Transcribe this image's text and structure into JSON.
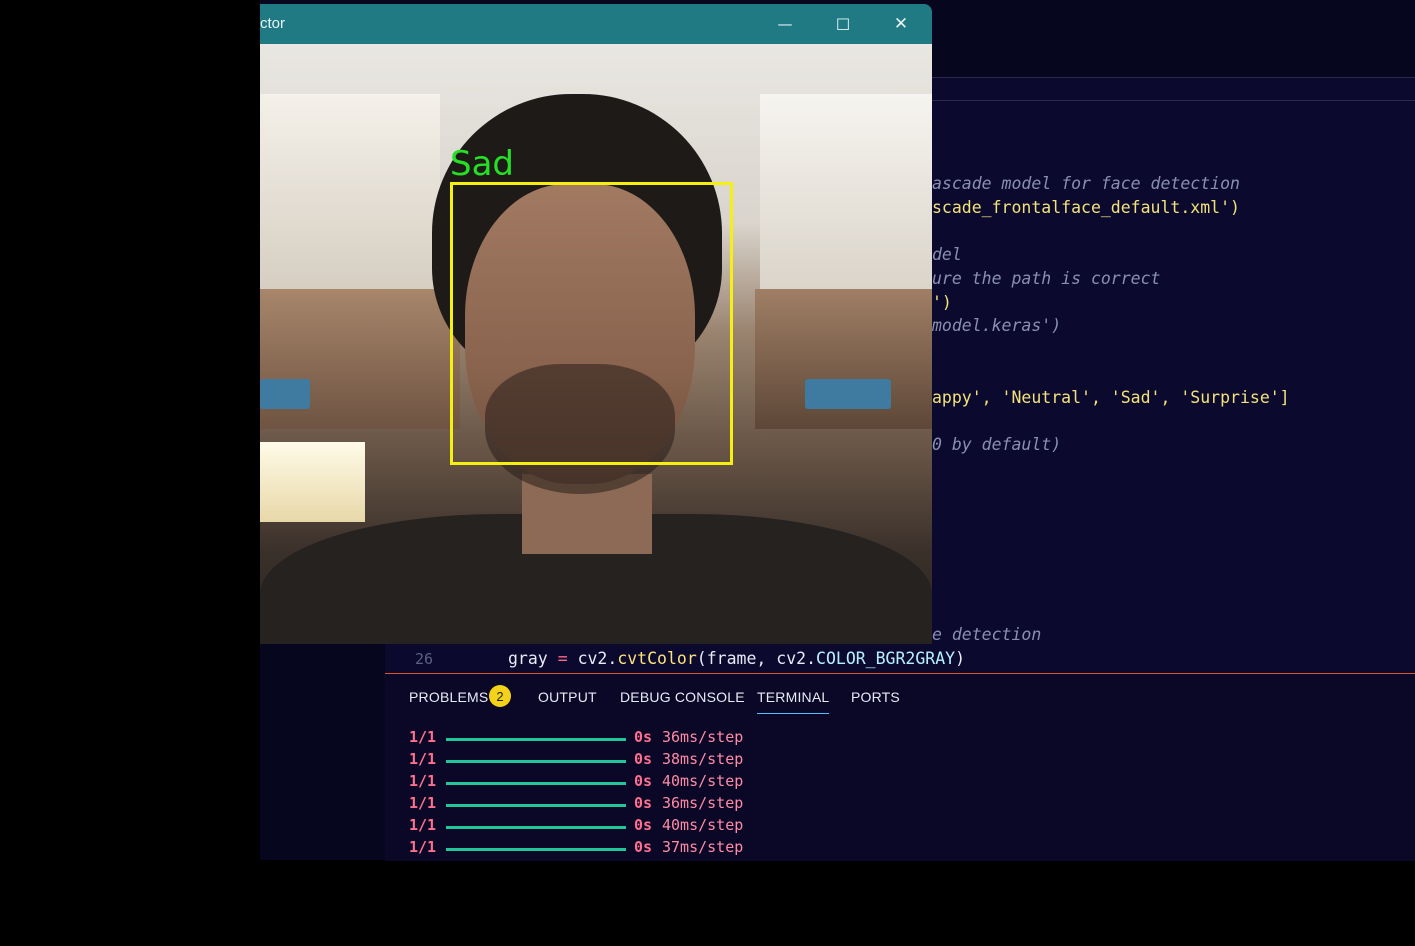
{
  "window": {
    "title": "ctor",
    "minimize_glyph": "—",
    "maximize_glyph": "☐",
    "close_glyph": "✕"
  },
  "camera": {
    "emotion_label": "Sad",
    "box_color": "#f5ef12",
    "label_color": "#25e025"
  },
  "editor": {
    "lines": [
      {
        "text": "ascade model for face detection",
        "kind": "cmt"
      },
      {
        "text": "scade_frontalface_default.xml')",
        "kind": "str"
      },
      {
        "text": "del",
        "kind": "cmt"
      },
      {
        "text": "ure the path is correct",
        "kind": "cmt"
      },
      {
        "text": "')",
        "kind": "str"
      },
      {
        "text": "model.keras')",
        "kind": "cmt"
      },
      {
        "text": "appy', 'Neutral', 'Sad', 'Surprise']",
        "kind": "str"
      },
      {
        "text": "0 by default)",
        "kind": "cmt"
      },
      {
        "text": "e detection",
        "kind": "cmt"
      }
    ],
    "line26": {
      "number": "26",
      "var": "gray",
      "op": "=",
      "module": "cv2.",
      "func": "cvtColor",
      "args_open": "(frame, cv2.",
      "const": "COLOR_BGR2GRAY",
      "args_close": ")"
    }
  },
  "panel": {
    "tabs": [
      {
        "label": "PROBLEMS"
      },
      {
        "label": "OUTPUT"
      },
      {
        "label": "DEBUG CONSOLE"
      },
      {
        "label": "TERMINAL"
      },
      {
        "label": "PORTS"
      }
    ],
    "problems_count": "2",
    "terminal_rows": [
      {
        "count": "1/1",
        "time": "0s",
        "step": "36ms/step",
        "progress": 1.0
      },
      {
        "count": "1/1",
        "time": "0s",
        "step": "38ms/step",
        "progress": 1.0
      },
      {
        "count": "1/1",
        "time": "0s",
        "step": "40ms/step",
        "progress": 1.0
      },
      {
        "count": "1/1",
        "time": "0s",
        "step": "36ms/step",
        "progress": 1.0
      },
      {
        "count": "1/1",
        "time": "0s",
        "step": "40ms/step",
        "progress": 1.0
      },
      {
        "count": "1/1",
        "time": "0s",
        "step": "37ms/step",
        "progress": 1.0
      }
    ]
  }
}
